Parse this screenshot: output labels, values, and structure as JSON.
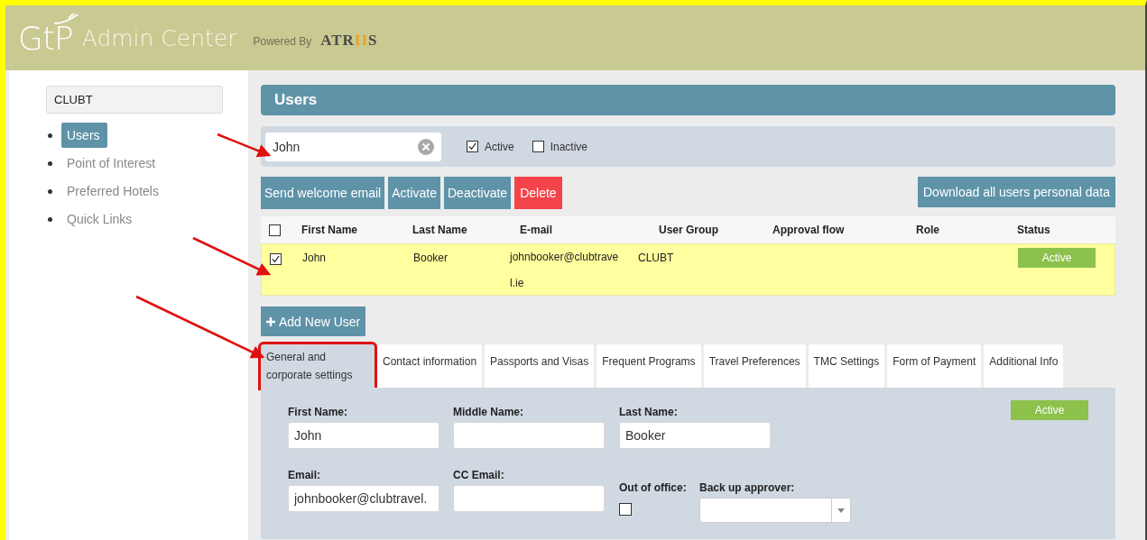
{
  "header": {
    "logo": "GtP",
    "title": "Admin Center",
    "powered_by": "Powered By",
    "partner_logo": [
      {
        "text": "ATR",
        "accent": false
      },
      {
        "text": "II",
        "accent": true
      },
      {
        "text": "S",
        "accent": false
      }
    ]
  },
  "sidebar": {
    "company": "CLUBT",
    "items": [
      {
        "label": "Users",
        "selected": true
      },
      {
        "label": "Point of Interest",
        "selected": false
      },
      {
        "label": "Preferred Hotels",
        "selected": false
      },
      {
        "label": "Quick Links",
        "selected": false
      }
    ]
  },
  "page_title": "Users",
  "search": {
    "value": "John",
    "filters": [
      {
        "label": "Active",
        "checked": true
      },
      {
        "label": "Inactive",
        "checked": false
      }
    ]
  },
  "actions": [
    {
      "label": "Send welcome email",
      "kind": "normal"
    },
    {
      "label": "Activate",
      "kind": "normal"
    },
    {
      "label": "Deactivate",
      "kind": "normal"
    },
    {
      "label": "Delete",
      "kind": "danger"
    }
  ],
  "download_button": "Download all users personal data",
  "table": {
    "all_checked": false,
    "columns": [
      "First Name",
      "Last Name",
      "E-mail",
      "User Group",
      "Approval flow",
      "Role",
      "Status"
    ],
    "rows": [
      {
        "checked": true,
        "first_name": "John",
        "last_name": "Booker",
        "email": "johnbooker@clubtravel.ie",
        "user_group": "CLUBT",
        "status": "Active"
      }
    ]
  },
  "add_button": "Add New User",
  "tabs": [
    {
      "label": "General and corporate settings",
      "selected": true,
      "highlighted": true
    },
    {
      "label": "Contact information",
      "selected": false,
      "highlighted": false
    },
    {
      "label": "Passports and Visas",
      "selected": false,
      "highlighted": false
    },
    {
      "label": "Frequent Programs",
      "selected": false,
      "highlighted": false
    },
    {
      "label": "Travel Preferences",
      "selected": false,
      "highlighted": false
    },
    {
      "label": "TMC Settings",
      "selected": false,
      "highlighted": false
    },
    {
      "label": "Form of Payment",
      "selected": false,
      "highlighted": false
    },
    {
      "label": "Additional Info",
      "selected": false,
      "highlighted": false
    }
  ],
  "form": {
    "status": "Active",
    "fields": [
      {
        "label": "First Name:",
        "value": "John",
        "kind": "text"
      },
      {
        "label": "Middle Name:",
        "kind": "text"
      },
      {
        "label": "Last Name:",
        "value": "Booker",
        "kind": "text"
      },
      {
        "label": "Email:",
        "value": "johnbooker@clubtravel.",
        "kind": "text"
      },
      {
        "label": "CC Email:",
        "kind": "text"
      },
      {
        "label": "Out of office:",
        "checked": false,
        "kind": "checkbox"
      },
      {
        "label": "Back up approver:",
        "kind": "select"
      }
    ]
  }
}
